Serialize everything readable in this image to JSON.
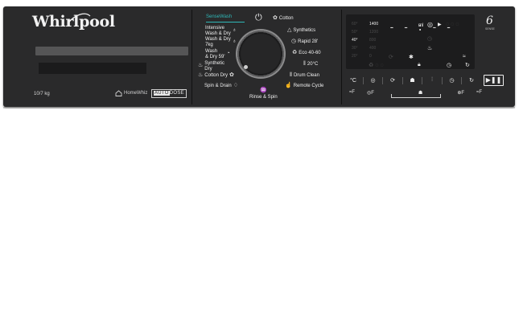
{
  "brand": {
    "logo": "Whirlpool",
    "capacity": "10/7 kg",
    "homewhiz": "HomeWhiz",
    "autodose_prefix": "AUTO",
    "autodose_suffix": "DOSE"
  },
  "programs_left": [
    {
      "label": "SenseWash",
      "icon": ""
    },
    {
      "label": "Intensive\nWash & Dry",
      "icon": "shirt-icon"
    },
    {
      "label": "Wash & Dry\n7kg",
      "icon": "shirt-icon"
    },
    {
      "label": "Wash\n& Dry 59'",
      "icon": "timer-icon"
    },
    {
      "label": "Synthetic\nDry",
      "icon": "synthetic-dry-icon"
    },
    {
      "label": "Cotton Dry",
      "icon": "cotton-dry-icon"
    },
    {
      "label": "Spin & Drain",
      "icon": "drain-icon"
    }
  ],
  "programs_right": [
    {
      "label": "Cotton",
      "icon": "cotton-icon"
    },
    {
      "label": "Synthetics",
      "icon": "synthetics-icon"
    },
    {
      "label": "Rapid 28'",
      "icon": "rapid-icon"
    },
    {
      "label": "Eco 40-60",
      "icon": "eco-icon"
    },
    {
      "label": "20°C",
      "icon": "temp-icon"
    },
    {
      "label": "Drum Clean",
      "icon": "drum-icon"
    },
    {
      "label": "Remote Cycle",
      "icon": "remote-icon"
    }
  ],
  "program_bottom": {
    "label": "Rinse & Spin",
    "icon": "rinse-icon"
  },
  "display": {
    "temps": [
      "60°",
      "50°",
      "40°",
      "30°",
      "20°"
    ],
    "speeds": [
      "1400",
      "1200",
      "800",
      "400",
      "0"
    ],
    "segment": "- - : - -",
    "unit_ml": "ml"
  },
  "series_badge": {
    "number": "6",
    "text": "SENSE"
  },
  "options": [
    {
      "label": "°C",
      "icon": "temperature-icon"
    },
    {
      "label": "◎",
      "icon": "spin-icon"
    },
    {
      "label": "⟳",
      "icon": "dry-icon"
    },
    {
      "label": "☗",
      "icon": "detergent-icon"
    },
    {
      "label": "⫶",
      "icon": "steam-icon"
    },
    {
      "label": "◷",
      "icon": "delay-icon"
    },
    {
      "label": "↻",
      "icon": "remote-icon"
    }
  ],
  "start_label": "▶❚❚",
  "option_sublabels": [
    "≈F",
    "◎F",
    "☗",
    "⊕F",
    "≈F"
  ],
  "colors": {
    "panel": "#2a2a2b",
    "accent": "#2fb8b8",
    "text": "#f0f0f0"
  }
}
